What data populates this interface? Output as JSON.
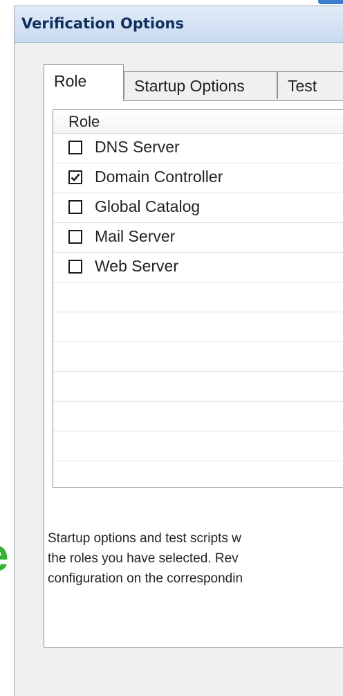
{
  "window": {
    "title": "Verification Options"
  },
  "tabs": [
    {
      "label": "Role",
      "active": true
    },
    {
      "label": "Startup Options",
      "active": false
    },
    {
      "label": "Test",
      "active": false
    }
  ],
  "role_list": {
    "column_header": "Role",
    "items": [
      {
        "label": "DNS Server",
        "checked": false
      },
      {
        "label": "Domain Controller",
        "checked": true
      },
      {
        "label": "Global Catalog",
        "checked": false
      },
      {
        "label": "Mail Server",
        "checked": false
      },
      {
        "label": "Web Server",
        "checked": false
      }
    ]
  },
  "description": {
    "lines": [
      "Startup options and test scripts w",
      "the roles you have selected. Rev",
      "configuration on the correspondin"
    ]
  },
  "background": {
    "glyph": "e"
  },
  "colors": {
    "title_text": "#0e2f5e",
    "title_bar": "#c8d9ef",
    "glyph": "#34b234",
    "accent": "#3b7fd0"
  }
}
